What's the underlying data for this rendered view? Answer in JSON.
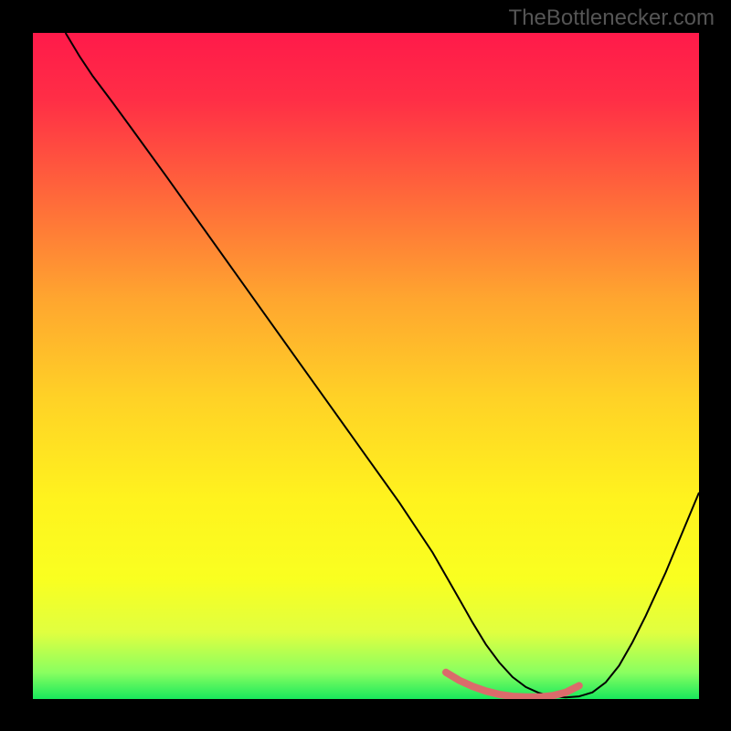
{
  "watermark": "TheBottlenecker.com",
  "gradient": {
    "stops": [
      {
        "offset": 0.0,
        "color": "#ff1a4a"
      },
      {
        "offset": 0.1,
        "color": "#ff2e46"
      },
      {
        "offset": 0.25,
        "color": "#ff6a3a"
      },
      {
        "offset": 0.4,
        "color": "#ffa62f"
      },
      {
        "offset": 0.55,
        "color": "#ffd226"
      },
      {
        "offset": 0.7,
        "color": "#fff31e"
      },
      {
        "offset": 0.82,
        "color": "#f9ff20"
      },
      {
        "offset": 0.9,
        "color": "#e0ff40"
      },
      {
        "offset": 0.96,
        "color": "#8aff60"
      },
      {
        "offset": 1.0,
        "color": "#18e85c"
      }
    ]
  },
  "chart_data": {
    "type": "line",
    "title": "",
    "xlabel": "",
    "ylabel": "",
    "xlim": [
      0,
      100
    ],
    "ylim": [
      0,
      100
    ],
    "series": [
      {
        "name": "curve",
        "stroke": "#000000",
        "x": [
          4.9,
          7,
          9,
          12,
          15,
          20,
          25,
          30,
          35,
          40,
          45,
          50,
          55,
          60,
          62,
          64,
          66,
          68,
          70,
          72,
          74,
          76,
          78,
          80,
          82,
          84,
          86,
          88,
          90,
          92,
          95,
          100
        ],
        "y": [
          100,
          96.5,
          93.5,
          89.5,
          85.4,
          78.5,
          71.5,
          64.5,
          57.5,
          50.5,
          43.5,
          36.5,
          29.5,
          22,
          18.5,
          15,
          11.5,
          8.2,
          5.5,
          3.3,
          1.8,
          0.9,
          0.4,
          0.25,
          0.4,
          1.0,
          2.5,
          5.0,
          8.5,
          12.5,
          19,
          31
        ]
      },
      {
        "name": "highlight",
        "stroke": "#db6b6b",
        "x": [
          62,
          64,
          66,
          68,
          70,
          72,
          74,
          76,
          78,
          80,
          82
        ],
        "y": [
          4.0,
          2.8,
          1.9,
          1.2,
          0.7,
          0.4,
          0.3,
          0.3,
          0.5,
          1.0,
          2.0
        ]
      }
    ]
  }
}
